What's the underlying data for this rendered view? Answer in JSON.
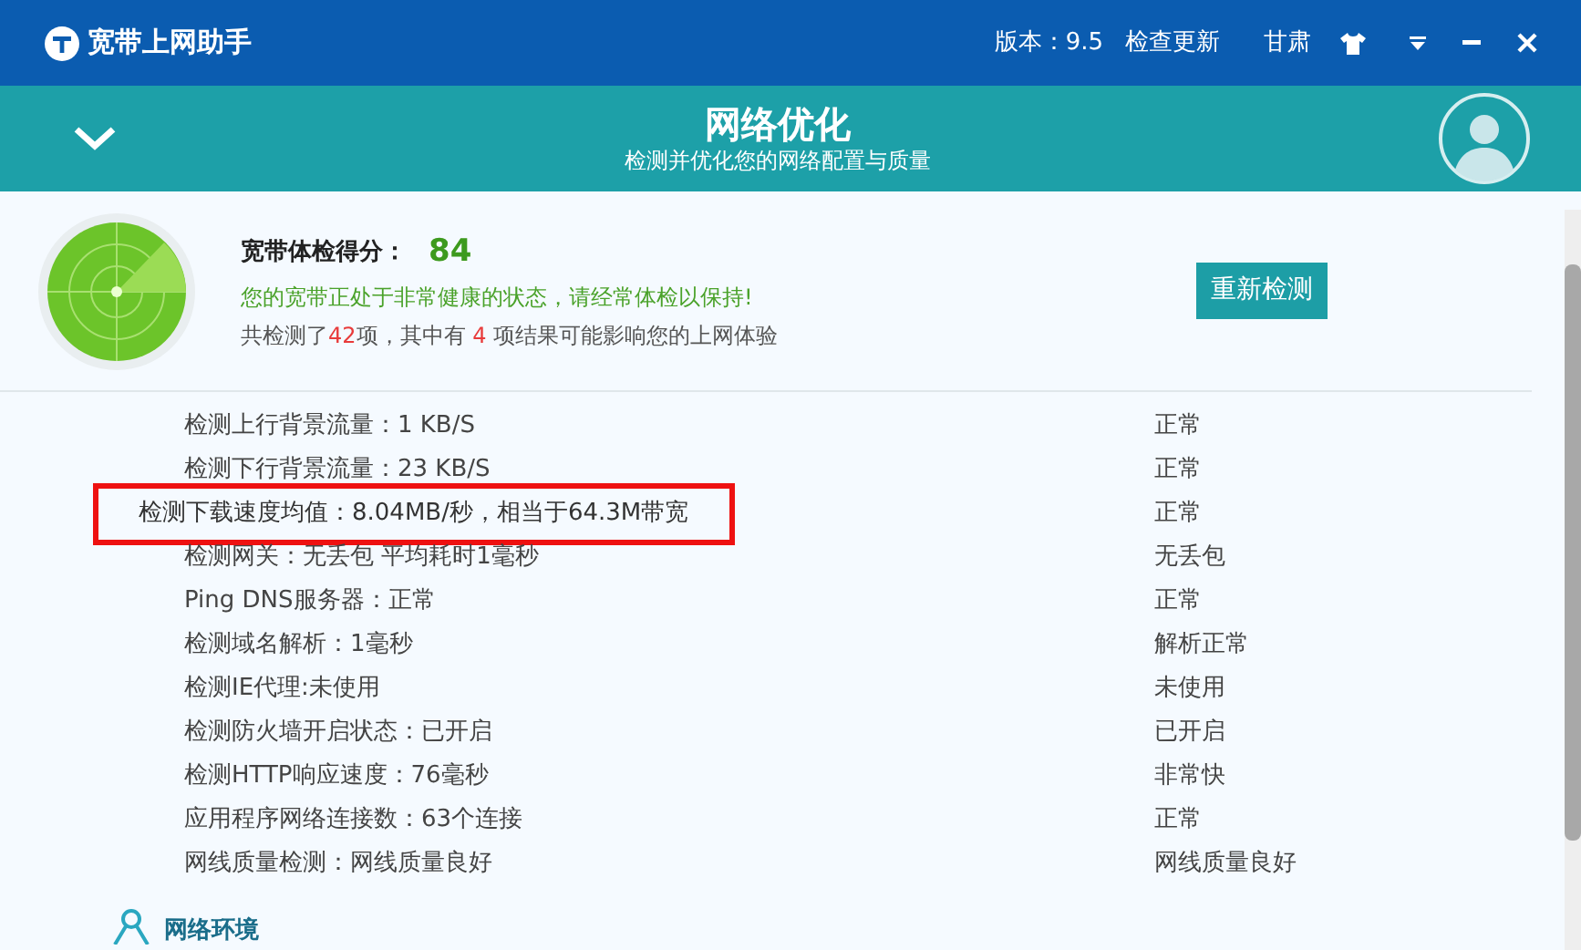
{
  "titlebar": {
    "app_name": "宽带上网助手",
    "version": "版本：9.5",
    "update": "检查更新",
    "region": "甘肃"
  },
  "header": {
    "title": "网络优化",
    "subtitle": "检测并优化您的网络配置与质量"
  },
  "summary": {
    "score_label": "宽带体检得分：",
    "score": "84",
    "message": "您的宽带正处于非常健康的状态，请经常体检以保持!",
    "detail": [
      {
        "kind": "text",
        "text": "共检测了"
      },
      {
        "kind": "count",
        "text": "42"
      },
      {
        "kind": "text",
        "text": "项，其中有 "
      },
      {
        "kind": "count",
        "text": "4"
      },
      {
        "kind": "text",
        "text": " 项结果可能影响您的上网体验"
      }
    ],
    "recheck_button": "重新检测"
  },
  "results": [
    {
      "item": "检测上行背景流量：1 KB/S",
      "status": "正常",
      "highlighted": false
    },
    {
      "item": "检测下行背景流量：23 KB/S",
      "status": "正常",
      "highlighted": false
    },
    {
      "item": "检测下载速度均值：8.04MB/秒，相当于64.3M带宽",
      "status": "正常",
      "highlighted": true
    },
    {
      "item": "检测网关：无丢包 平均耗时1毫秒",
      "status": "无丢包",
      "highlighted": false
    },
    {
      "item": "Ping DNS服务器：正常",
      "status": "正常",
      "highlighted": false
    },
    {
      "item": "检测域名解析：1毫秒",
      "status": "解析正常",
      "highlighted": false
    },
    {
      "item": "检测IE代理:未使用",
      "status": "未使用",
      "highlighted": false
    },
    {
      "item": "检测防火墙开启状态：已开启",
      "status": "已开启",
      "highlighted": false
    },
    {
      "item": "检测HTTP响应速度：76毫秒",
      "status": "非常快",
      "highlighted": false
    },
    {
      "item": "应用程序网络连接数：63个连接",
      "status": "正常",
      "highlighted": false
    },
    {
      "item": "网线质量检测：网线质量良好",
      "status": "网线质量良好",
      "highlighted": false
    }
  ],
  "next_section": {
    "title": "网络环境"
  }
}
